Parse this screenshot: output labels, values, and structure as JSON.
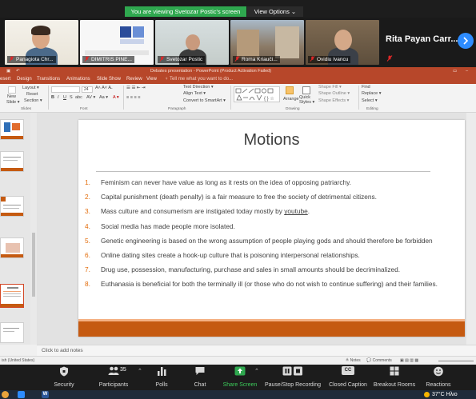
{
  "banner": {
    "viewing_text": "You are viewing Svetozar Postic's screen",
    "view_options_label": "View Options ⌄"
  },
  "participants": [
    {
      "name": "Panagiota Chr..."
    },
    {
      "name": "DIMITRIS PINE..."
    },
    {
      "name": "Svetozar Postic"
    },
    {
      "name": "Roma Kriaučì..."
    },
    {
      "name": "Ovidiu Ivancu"
    }
  ],
  "rita": {
    "name": "Rita Payan Carr..."
  },
  "ppt": {
    "window_title": "Debates presentation - PowerPoint (Product Activation Failed)",
    "tabs": [
      "esert",
      "Design",
      "Transitions",
      "Animations",
      "Slide Show",
      "Review",
      "View"
    ],
    "tell_me": "♀ Tell me what you want to do...",
    "ribbon": {
      "layout": "Layout ▾",
      "reset": "Reset",
      "new_slide": "New",
      "slide_label": "Slide ▾",
      "section": "Section ▾",
      "font_size": "24",
      "text_direction": "Text Direction ▾",
      "align_text": "Align Text ▾",
      "convert_smartart": "Convert to SmartArt ▾",
      "arrange": "Arrange",
      "quick_styles": "Quick Styles ▾",
      "shape_fill": "Shape Fill ▾",
      "shape_outline": "Shape Outline ▾",
      "shape_effects": "Shape Effects ▾",
      "find": "Find",
      "replace": "Replace ▾",
      "select": "Select ▾",
      "groups": [
        "Slides",
        "Font",
        "Paragraph",
        "Drawing",
        "Editing"
      ]
    },
    "slide": {
      "title": "Motions",
      "motions": [
        {
          "num": "1.",
          "text": "Feminism can never have value as long as it rests on the idea of opposing patriarchy."
        },
        {
          "num": "2.",
          "text": "Capital punishment (death penalty) is a fair measure to free the society of detrimental citizens."
        },
        {
          "num": "3.",
          "text_before": "Mass culture and consumerism are instigated today mostly by ",
          "text_underlined": "youtube",
          "text_after": "."
        },
        {
          "num": "4.",
          "text": "Social media has made people more isolated."
        },
        {
          "num": "5.",
          "text": "Genetic engineering is based on the wrong assumption of people playing gods and should therefore be forbidden"
        },
        {
          "num": "6.",
          "text": "Online dating sites create a hook-up culture that is poisoning interpersonal relationships."
        },
        {
          "num": "7.",
          "text": "Drug use, possession, manufacturing, purchase and sales in small amounts should be decriminalized."
        },
        {
          "num": "8.",
          "text": "Euthanasia is beneficial for both the terminally ill (or those who do not wish to continue suffering) and their families."
        }
      ]
    },
    "notes_placeholder": "Click to add notes",
    "status": {
      "language": "ish (United States)",
      "notes": "≜ Notes",
      "comments": "💬 Comments"
    }
  },
  "toolbar": {
    "security": "Security",
    "participants": "Participants",
    "participants_count": "35",
    "polls": "Polls",
    "chat": "Chat",
    "share_screen": "Share Screen",
    "recording": "Pause/Stop Recording",
    "closed_caption": "Closed Caption",
    "cc_icon_text": "CC",
    "breakout": "Breakout Rooms",
    "reactions": "Reactions"
  },
  "taskbar": {
    "weather": "37°C Ηλιο",
    "word_icon_text": "W"
  },
  "colors": {
    "zoom_green": "#2fa84f",
    "zoom_blue": "#2d8cff",
    "ppt_red": "#b7472a",
    "slide_footer": "#c55a11",
    "motion_number": "#e36c0a"
  }
}
